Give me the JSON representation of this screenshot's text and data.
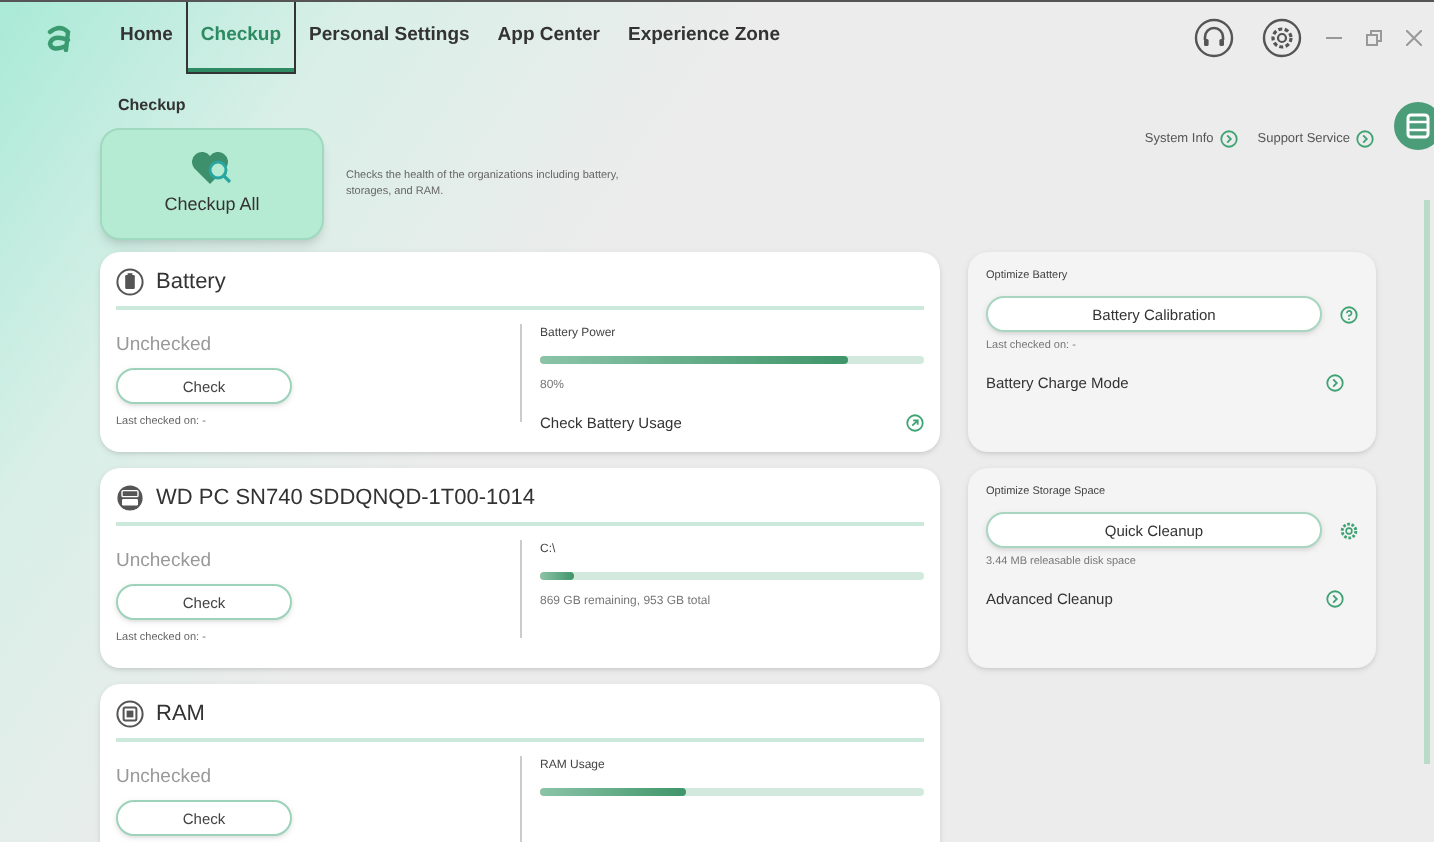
{
  "nav": {
    "tabs": [
      {
        "label": "Home",
        "selected": false
      },
      {
        "label": "Checkup",
        "selected": true
      },
      {
        "label": "Personal Settings",
        "selected": false
      },
      {
        "label": "App Center",
        "selected": false
      },
      {
        "label": "Experience Zone",
        "selected": false
      }
    ]
  },
  "page": {
    "heading": "Checkup",
    "checkup_all": "Checkup All",
    "description": "Checks the health of the organizations including battery, storages, and RAM.",
    "links": [
      "System Info",
      "Support Service"
    ]
  },
  "cards": [
    {
      "kind": "battery",
      "title": "Battery",
      "status": "Unchecked",
      "button": "Check",
      "last_checked": "Last checked on: -",
      "meter_label": "Battery Power",
      "level": 0.8,
      "reading": "80%",
      "link": "Check Battery Usage"
    },
    {
      "kind": "storage",
      "title": "WD PC SN740 SDDQNQD-1T00-1014",
      "status": "Unchecked",
      "button": "Check",
      "last_checked": "Last checked on: -",
      "meter_label": "C:\\",
      "level": 0.09,
      "reading": "869 GB remaining, 953 GB total"
    },
    {
      "kind": "ram",
      "title": "RAM",
      "status": "Unchecked",
      "button": "Check",
      "meter_label": "RAM Usage",
      "level": 0.38
    }
  ],
  "optimize": [
    {
      "kind": "battery",
      "title": "Optimize Battery",
      "button": "Battery Calibration",
      "note": "Last checked on: -",
      "link": "Battery Charge Mode"
    },
    {
      "kind": "storage",
      "title": "Optimize Storage Space",
      "button": "Quick Cleanup",
      "note": "3.44 MB releasable disk space",
      "link": "Advanced Cleanup"
    }
  ]
}
